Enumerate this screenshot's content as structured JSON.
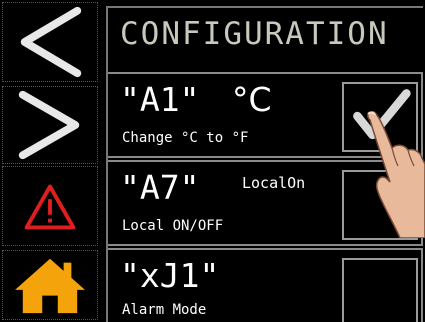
{
  "screen": {
    "title": "CONFIGURATION"
  },
  "nav": [
    {
      "name": "back",
      "icon": "chevron-left-icon"
    },
    {
      "name": "next",
      "icon": "chevron-right-icon"
    },
    {
      "name": "alarm",
      "icon": "warning-triangle-icon",
      "color": "#e01e1e"
    },
    {
      "name": "home",
      "icon": "home-icon",
      "color": "#f5a30a"
    }
  ],
  "params": [
    {
      "code": "\"A1\"",
      "extra": "°C",
      "description": "Change °C to °F",
      "checked": true
    },
    {
      "code": "\"A7\"",
      "extra": "LocalOn",
      "description": "Local ON/OFF",
      "checked": false
    },
    {
      "code": "\"xJ1\"",
      "extra": "",
      "description": "Alarm Mode",
      "checked": false
    }
  ],
  "colors": {
    "background": "#000000",
    "title": "#c8c8bc",
    "border": "#8a8a8a"
  }
}
